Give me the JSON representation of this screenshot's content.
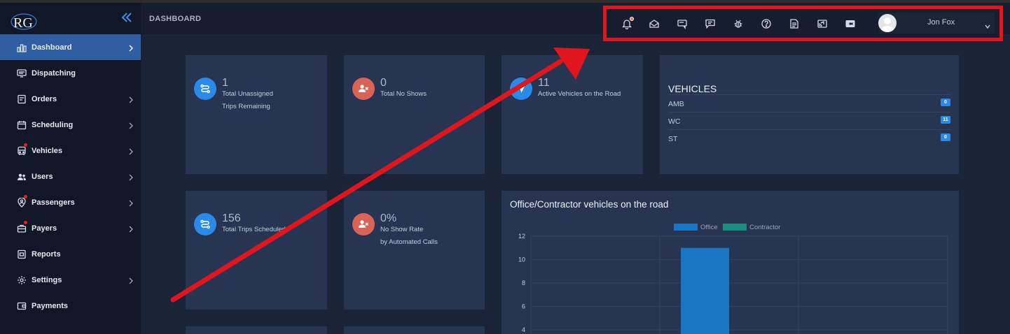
{
  "sidebar": {
    "logo_text": "RG",
    "items": [
      {
        "label": "Dashboard",
        "icon": "chart-bar-icon",
        "active": true,
        "chevron": true,
        "dot": false
      },
      {
        "label": "Dispatching",
        "icon": "monitor-icon",
        "active": false,
        "chevron": false,
        "dot": false
      },
      {
        "label": "Orders",
        "icon": "document-icon",
        "active": false,
        "chevron": true,
        "dot": false
      },
      {
        "label": "Scheduling",
        "icon": "calendar-icon",
        "active": false,
        "chevron": true,
        "dot": false
      },
      {
        "label": "Vehicles",
        "icon": "bus-icon",
        "active": false,
        "chevron": true,
        "dot": true
      },
      {
        "label": "Users",
        "icon": "users-icon",
        "active": false,
        "chevron": true,
        "dot": false
      },
      {
        "label": "Passengers",
        "icon": "location-user-icon",
        "active": false,
        "chevron": true,
        "dot": true
      },
      {
        "label": "Payers",
        "icon": "briefcase-icon",
        "active": false,
        "chevron": true,
        "dot": true
      },
      {
        "label": "Reports",
        "icon": "report-icon",
        "active": false,
        "chevron": false,
        "dot": false
      },
      {
        "label": "Settings",
        "icon": "gear-icon",
        "active": false,
        "chevron": true,
        "dot": false
      },
      {
        "label": "Payments",
        "icon": "wallet-icon",
        "active": false,
        "chevron": false,
        "dot": false
      }
    ]
  },
  "header": {
    "title": "DASHBOARD",
    "toolbar_icons": [
      "bell-icon",
      "mail-open-icon",
      "ticket-icon",
      "chat-icon",
      "bug-icon",
      "help-icon",
      "note-icon",
      "cast-icon",
      "video-icon"
    ],
    "user_name": "Jon Fox"
  },
  "stats": [
    {
      "value": "1",
      "line1": "Total Unassigned",
      "line2": "Trips Remaining",
      "color": "blue",
      "icon": "route-icon"
    },
    {
      "value": "0",
      "line1": "Total No Shows",
      "line2": "",
      "color": "red",
      "icon": "user-x-icon"
    },
    {
      "value": "11",
      "line1": "Active Vehicles on the Road",
      "line2": "",
      "color": "blue",
      "icon": "navigation-icon"
    },
    {
      "value": "156",
      "line1": "Total Trips Scheduled",
      "line2": "",
      "color": "blue",
      "icon": "route-icon"
    },
    {
      "value": "0%",
      "line1": "No Show Rate",
      "line2": "by Automated Calls",
      "color": "red",
      "icon": "user-x-icon"
    }
  ],
  "vehicles": {
    "title": "VEHICLES",
    "rows": [
      {
        "name": "AMB",
        "count": "0"
      },
      {
        "name": "WC",
        "count": "11"
      },
      {
        "name": "ST",
        "count": "0"
      }
    ]
  },
  "chart_data": {
    "type": "bar",
    "title": "Office/Contractor vehicles on the road",
    "series": [
      {
        "name": "Office",
        "values": [
          null,
          11,
          null
        ],
        "color": "#1a76c2"
      },
      {
        "name": "Contractor",
        "values": [
          null,
          0,
          null
        ],
        "color": "#1a8c80"
      }
    ],
    "y_ticks": [
      "12",
      "10",
      "8",
      "6",
      "4"
    ],
    "ylim": [
      0,
      12
    ],
    "grid": true,
    "legend": "top-center"
  },
  "colors": {
    "accent": "#2a8ae7",
    "danger": "#d86456",
    "highlight": "#e0161c"
  }
}
